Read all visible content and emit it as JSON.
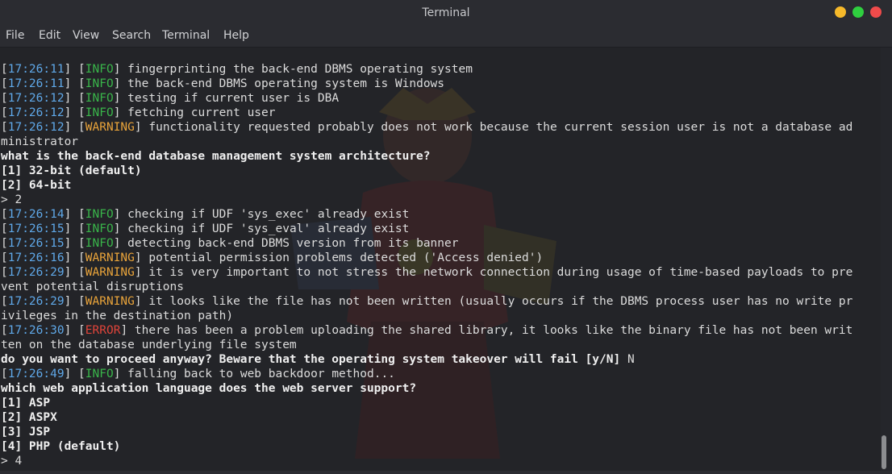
{
  "window": {
    "title": "Terminal",
    "controls": {
      "minimize_color": "#f6b92a",
      "maximize_color": "#2fcf3f",
      "close_color": "#ef4b4b"
    }
  },
  "menu": [
    "File",
    "Edit",
    "View",
    "Search",
    "Terminal",
    "Help"
  ],
  "terminal": {
    "lines": [
      {
        "ts": "17:26:11",
        "level": "INFO",
        "msg": " fingerprinting the back-end DBMS operating system"
      },
      {
        "ts": "17:26:11",
        "level": "INFO",
        "msg": " the back-end DBMS operating system is Windows"
      },
      {
        "ts": "17:26:12",
        "level": "INFO",
        "msg": " testing if current user is DBA"
      },
      {
        "ts": "17:26:12",
        "level": "INFO",
        "msg": " fetching current user"
      },
      {
        "ts": "17:26:12",
        "level": "WARNING",
        "msg": " functionality requested probably does not work because the current session user is not a database ad"
      },
      {
        "text": "ministrator"
      },
      {
        "text": "what is the back-end database management system architecture?",
        "bold": true
      },
      {
        "text": "[1] 32-bit (default)",
        "bold": true
      },
      {
        "text": "[2] 64-bit",
        "bold": true
      },
      {
        "text": "> 2"
      },
      {
        "ts": "17:26:14",
        "level": "INFO",
        "msg": " checking if UDF 'sys_exec' already exist"
      },
      {
        "ts": "17:26:15",
        "level": "INFO",
        "msg": " checking if UDF 'sys_eval' already exist"
      },
      {
        "ts": "17:26:15",
        "level": "INFO",
        "msg": " detecting back-end DBMS version from its banner"
      },
      {
        "ts": "17:26:16",
        "level": "WARNING",
        "msg": " potential permission problems detected ('Access denied')"
      },
      {
        "ts": "17:26:29",
        "level": "WARNING",
        "msg": " it is very important to not stress the network connection during usage of time-based payloads to pre"
      },
      {
        "text": "vent potential disruptions"
      },
      {
        "ts": "17:26:29",
        "level": "WARNING",
        "msg": " it looks like the file has not been written (usually occurs if the DBMS process user has no write pr"
      },
      {
        "text": "ivileges in the destination path)"
      },
      {
        "ts": "17:26:30",
        "level": "ERROR",
        "msg": " there has been a problem uploading the shared library, it looks like the binary file has not been writ"
      },
      {
        "text": "ten on the database underlying file system"
      },
      {
        "text": "do you want to proceed anyway? Beware that the operating system takeover will fail [y/N] ",
        "bold": true,
        "suffix": "N"
      },
      {
        "ts": "17:26:49",
        "level": "INFO",
        "msg": " falling back to web backdoor method..."
      },
      {
        "text": "which web application language does the web server support?",
        "bold": true
      },
      {
        "text": "[1] ASP",
        "bold": true
      },
      {
        "text": "[2] ASPX",
        "bold": true
      },
      {
        "text": "[3] JSP",
        "bold": true
      },
      {
        "text": "[4] PHP (default)",
        "bold": true
      },
      {
        "text": "> 4"
      }
    ],
    "colors": {
      "timestamp": "#5fa8e8",
      "info": "#39b54a",
      "warning": "#e8a33a",
      "error": "#e0443a"
    }
  }
}
